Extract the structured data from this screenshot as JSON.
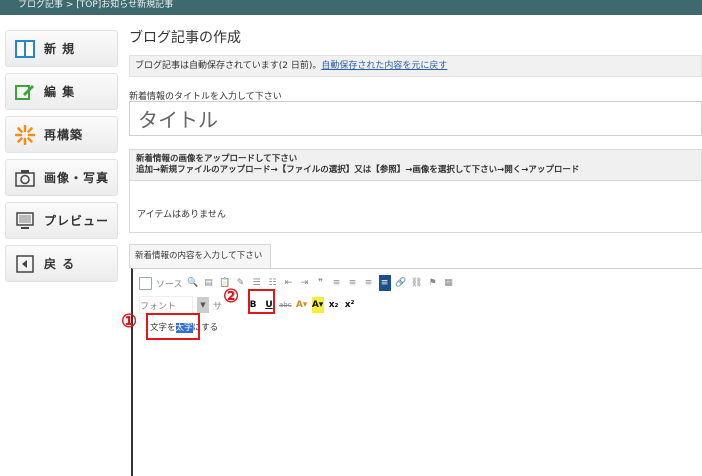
{
  "topbar": {
    "text": "ブログ記事 > [TOP]お知らせ新規記事"
  },
  "sidebar": {
    "items": [
      {
        "label": "新 規",
        "icon": "new-page-icon"
      },
      {
        "label": "編 集",
        "icon": "edit-icon"
      },
      {
        "label": "再構築",
        "icon": "rebuild-icon"
      },
      {
        "label": "画像・写真",
        "icon": "camera-icon"
      },
      {
        "label": "プレビュー",
        "icon": "preview-icon"
      },
      {
        "label": "戻 る",
        "icon": "back-icon"
      }
    ]
  },
  "main": {
    "page_title": "ブログ記事の作成",
    "autosave": {
      "message": "ブログ記事は自動保存されています(2 日前)。",
      "restore_link": "自動保存された内容を元に戻す"
    },
    "title_label": "新着情報のタイトルを入力して下さい",
    "title_value": "タイトル",
    "upload": {
      "heading_line1": "新着情報の画像をアップロードして下さい",
      "heading_line2": "追加→新規ファイルのアップロード→【ファイルの選択】又は【参照】→画像を選択して下さい→開く→アップロード",
      "empty_text": "アイテムはありません"
    },
    "content_tab": "新着情報の内容を入力して下さい",
    "editor": {
      "source_label": "ソース",
      "font_label": "フォント",
      "size_label": "サ",
      "bold_label": "B",
      "underline_label": "U",
      "strike_label": "abc",
      "text_before": "文字を",
      "text_selected": "太字",
      "text_after": "にする"
    },
    "annotations": {
      "step1": "①",
      "step2": "②"
    }
  },
  "colors": {
    "topbar": "#3e6a6e",
    "link": "#2a5db0",
    "highlight": "#e0161b",
    "selection": "#2f6fd3"
  }
}
